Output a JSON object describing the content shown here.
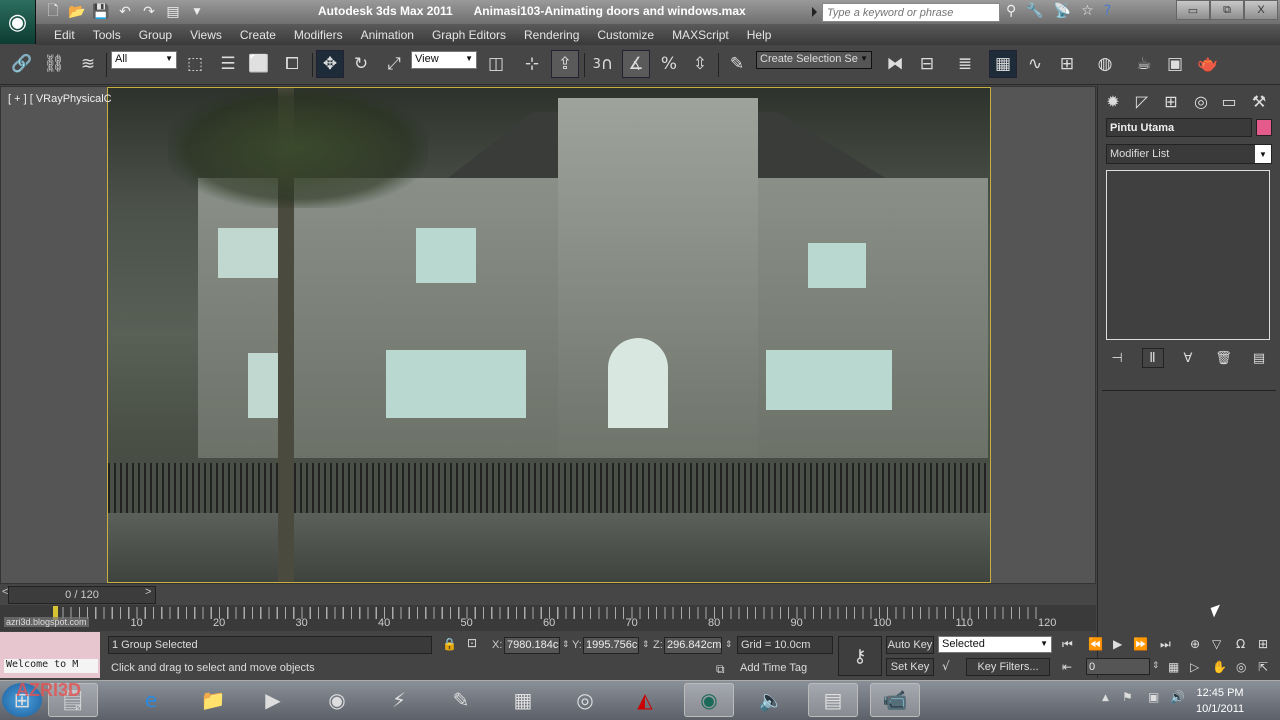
{
  "window": {
    "app_title": "Autodesk 3ds Max  2011",
    "file_title": "Animasi103-Animating doors and windows.max",
    "search_placeholder": "Type a keyword or phrase",
    "controls": {
      "minimize": "▭",
      "restore": "⧉",
      "close": "X"
    }
  },
  "quick_access": [
    "new-file-icon",
    "open-file-icon",
    "save-icon",
    "undo-icon",
    "redo-icon",
    "project-folder-icon",
    "customize-dropdown-icon"
  ],
  "menubar": [
    "Edit",
    "Tools",
    "Group",
    "Views",
    "Create",
    "Modifiers",
    "Animation",
    "Graph Editors",
    "Rendering",
    "Customize",
    "MAXScript",
    "Help"
  ],
  "toolbar": {
    "selection_filter": "All",
    "reference_coord": "View",
    "named_selection_placeholder": "Create Selection Se",
    "snap_label": "3",
    "tools": [
      "select-and-link",
      "unlink-selection",
      "bind-to-space-warp",
      "select-object",
      "select-by-name",
      "rectangular-selection",
      "window-crossing",
      "select-and-move",
      "select-and-rotate",
      "select-and-scale",
      "use-pivot-center",
      "select-and-manipulate",
      "keyboard-shortcut-override",
      "snaps-toggle",
      "angle-snap",
      "percent-snap",
      "spinner-snap",
      "edit-named-selection",
      "mirror",
      "align",
      "layer-manager",
      "graphite-modeling",
      "curve-editor",
      "schematic-view",
      "material-editor",
      "render-setup",
      "rendered-frame-window",
      "render-production"
    ]
  },
  "viewport": {
    "label": "[ + ] [ VRayPhysicalC"
  },
  "command_panel": {
    "tabs": [
      "create",
      "modify",
      "hierarchy",
      "motion",
      "display",
      "utilities"
    ],
    "object_name": "Pintu Utama",
    "object_color": "#e45a8a",
    "modifier_list": "Modifier List",
    "stack_buttons": [
      "pin-stack",
      "show-end-result",
      "make-unique",
      "remove-modifier",
      "configure-modifier-sets"
    ]
  },
  "timeline": {
    "frame_display": "0 / 120",
    "prev": "<",
    "next": ">",
    "current_frame": 0,
    "total_frames": 120,
    "tick_labels": [
      "10",
      "20",
      "30",
      "40",
      "50",
      "60",
      "70",
      "80",
      "90",
      "100",
      "110",
      "120"
    ]
  },
  "status": {
    "selection": "1 Group Selected",
    "prompt": "Click and drag to select and move objects",
    "x_label": "X:",
    "x_value": "7980.184c",
    "y_label": "Y:",
    "y_value": "1995.756c",
    "z_label": "Z:",
    "z_value": "296.842cm",
    "grid": "Grid = 10.0cm",
    "add_time_tag": "Add Time Tag",
    "listener_text": "Welcome to M"
  },
  "animation_controls": {
    "auto_key": "Auto Key",
    "set_key": "Set Key",
    "key_mode": "Selected",
    "key_filters": "Key Filters...",
    "current_frame_field": "0"
  },
  "taskbar": {
    "apps": [
      "start",
      "sticky-notes",
      "internet-explorer",
      "windows-explorer",
      "media-player",
      "google-chrome",
      "winamp",
      "sketchbook",
      "calculator",
      "media-center",
      "adobe-acrobat",
      "3ds-max",
      "volume-app",
      "control-panel",
      "camera-app"
    ],
    "time": "12:45 PM",
    "date": "10/1/2011"
  },
  "watermarks": {
    "logo": "AZRI3D",
    "blog": "azri3d.blogspot.com"
  }
}
